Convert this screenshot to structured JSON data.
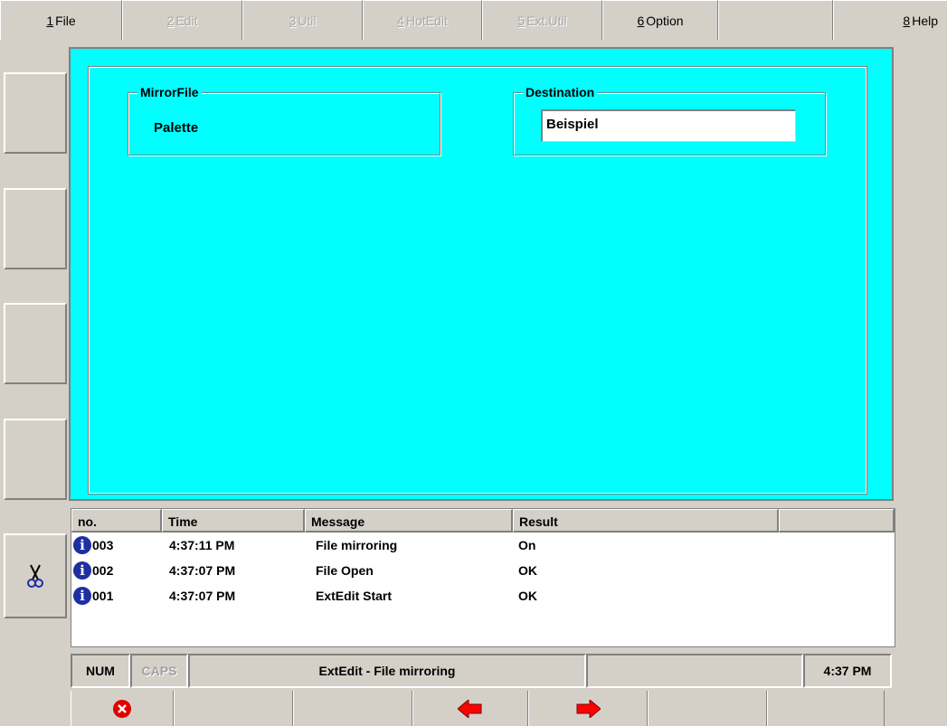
{
  "menu": [
    {
      "num": "1",
      "label": "File",
      "enabled": true
    },
    {
      "num": "2",
      "label": "Edit",
      "enabled": false
    },
    {
      "num": "3",
      "label": "Util",
      "enabled": false
    },
    {
      "num": "4",
      "label": "HotEdit",
      "enabled": false
    },
    {
      "num": "5",
      "label": "Ext.Util",
      "enabled": false
    },
    {
      "num": "6",
      "label": "Option",
      "enabled": true
    },
    {
      "num": "",
      "label": "",
      "enabled": true
    },
    {
      "num": "8",
      "label": "Help",
      "enabled": true
    }
  ],
  "mirror_file": {
    "legend": "MirrorFile",
    "value": "Palette"
  },
  "destination": {
    "legend": "Destination",
    "value": "Beispiel"
  },
  "log": {
    "columns": [
      "no.",
      "Time",
      "Message",
      "Result"
    ],
    "rows": [
      {
        "no": "003",
        "time": "4:37:11 PM",
        "message": "File mirroring",
        "result": "On"
      },
      {
        "no": "002",
        "time": "4:37:07 PM",
        "message": "File Open",
        "result": "OK"
      },
      {
        "no": "001",
        "time": "4:37:07 PM",
        "message": "ExtEdit Start",
        "result": "OK"
      }
    ]
  },
  "status": {
    "num": "NUM",
    "caps": "CAPS",
    "message": "ExtEdit - File mirroring",
    "extra": "",
    "time": "4:37 PM"
  },
  "icons": {
    "side": "scissors-icon",
    "close": "close-icon",
    "prev": "arrow-left-icon",
    "next": "arrow-right-icon"
  },
  "colors": {
    "panel": "#00ffff",
    "face": "#d4d0c8",
    "info": "#1e2fa0",
    "close": "#e00000",
    "arrow": "#ff0000"
  }
}
